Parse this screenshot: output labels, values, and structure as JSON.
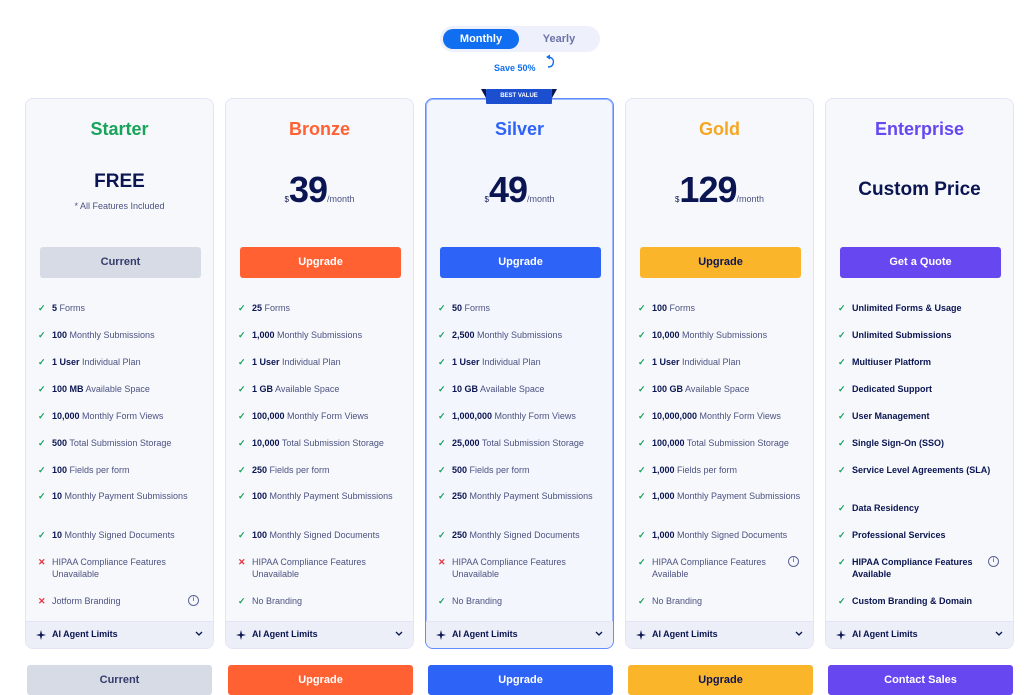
{
  "billing_toggle": {
    "monthly": "Monthly",
    "yearly": "Yearly",
    "save_note": "Save 50%"
  },
  "best_value": "BEST VALUE",
  "colors": {
    "starter": "#1aa35a",
    "bronze": "#ff6133",
    "silver": "#2d63f7",
    "gold": "#f5a623",
    "enterprise": "#6647f0",
    "gold_btn": "#fbb52b",
    "check": "#16a35b",
    "cross": "#e8333f"
  },
  "plans": [
    {
      "name": "Starter",
      "price_text": "FREE",
      "price_note": "* All Features Included",
      "button": "Current",
      "bottom_button": "Current",
      "features": [
        {
          "ok": true,
          "bold": "5",
          "text": " Forms"
        },
        {
          "ok": true,
          "bold": "100",
          "text": " Monthly Submissions"
        },
        {
          "ok": true,
          "bold": "1 User",
          "text": " Individual Plan"
        },
        {
          "ok": true,
          "bold": "100 MB",
          "text": " Available Space"
        },
        {
          "ok": true,
          "bold": "10,000",
          "text": " Monthly Form Views"
        },
        {
          "ok": true,
          "bold": "500",
          "text": " Total Submission Storage"
        },
        {
          "ok": true,
          "bold": "100",
          "text": " Fields per form"
        },
        {
          "ok": true,
          "bold": "10",
          "text": " Monthly Payment Submissions"
        },
        {
          "ok": true,
          "bold": "10",
          "text": " Monthly Signed Documents"
        },
        {
          "ok": false,
          "bold": "",
          "text": "HIPAA Compliance Features Unavailable"
        },
        {
          "ok": false,
          "bold": "",
          "text": "Jotform Branding",
          "info": true
        }
      ],
      "ai_label": "AI Agent Limits"
    },
    {
      "name": "Bronze",
      "currency": "$",
      "amount": "39",
      "period": "/month",
      "button": "Upgrade",
      "bottom_button": "Upgrade",
      "features": [
        {
          "ok": true,
          "bold": "25",
          "text": " Forms"
        },
        {
          "ok": true,
          "bold": "1,000",
          "text": " Monthly Submissions"
        },
        {
          "ok": true,
          "bold": "1 User",
          "text": " Individual Plan"
        },
        {
          "ok": true,
          "bold": "1 GB",
          "text": " Available Space"
        },
        {
          "ok": true,
          "bold": "100,000",
          "text": " Monthly Form Views"
        },
        {
          "ok": true,
          "bold": "10,000",
          "text": " Total Submission Storage"
        },
        {
          "ok": true,
          "bold": "250",
          "text": " Fields per form"
        },
        {
          "ok": true,
          "bold": "100",
          "text": " Monthly Payment Submissions"
        },
        {
          "ok": true,
          "bold": "100",
          "text": " Monthly Signed Documents"
        },
        {
          "ok": false,
          "bold": "",
          "text": "HIPAA Compliance Features Unavailable"
        },
        {
          "ok": true,
          "bold": "",
          "text": "No Branding"
        }
      ],
      "ai_label": "AI Agent Limits"
    },
    {
      "name": "Silver",
      "currency": "$",
      "amount": "49",
      "period": "/month",
      "button": "Upgrade",
      "bottom_button": "Upgrade",
      "features": [
        {
          "ok": true,
          "bold": "50",
          "text": " Forms"
        },
        {
          "ok": true,
          "bold": "2,500",
          "text": " Monthly Submissions"
        },
        {
          "ok": true,
          "bold": "1 User",
          "text": " Individual Plan"
        },
        {
          "ok": true,
          "bold": "10 GB",
          "text": " Available Space"
        },
        {
          "ok": true,
          "bold": "1,000,000",
          "text": " Monthly Form Views"
        },
        {
          "ok": true,
          "bold": "25,000",
          "text": " Total Submission Storage"
        },
        {
          "ok": true,
          "bold": "500",
          "text": " Fields per form"
        },
        {
          "ok": true,
          "bold": "250",
          "text": " Monthly Payment Submissions"
        },
        {
          "ok": true,
          "bold": "250",
          "text": " Monthly Signed Documents"
        },
        {
          "ok": false,
          "bold": "",
          "text": "HIPAA Compliance Features Unavailable"
        },
        {
          "ok": true,
          "bold": "",
          "text": "No Branding"
        }
      ],
      "ai_label": "AI Agent Limits"
    },
    {
      "name": "Gold",
      "currency": "$",
      "amount": "129",
      "period": "/month",
      "button": "Upgrade",
      "bottom_button": "Upgrade",
      "features": [
        {
          "ok": true,
          "bold": "100",
          "text": " Forms"
        },
        {
          "ok": true,
          "bold": "10,000",
          "text": " Monthly Submissions"
        },
        {
          "ok": true,
          "bold": "1 User",
          "text": " Individual Plan"
        },
        {
          "ok": true,
          "bold": "100 GB",
          "text": " Available Space"
        },
        {
          "ok": true,
          "bold": "10,000,000",
          "text": " Monthly Form Views"
        },
        {
          "ok": true,
          "bold": "100,000",
          "text": " Total Submission Storage"
        },
        {
          "ok": true,
          "bold": "1,000",
          "text": " Fields per form"
        },
        {
          "ok": true,
          "bold": "1,000",
          "text": " Monthly Payment Submissions"
        },
        {
          "ok": true,
          "bold": "1,000",
          "text": " Monthly Signed Documents"
        },
        {
          "ok": true,
          "bold": "",
          "text": "HIPAA Compliance Features Available",
          "info": true
        },
        {
          "ok": true,
          "bold": "",
          "text": "No Branding"
        }
      ],
      "ai_label": "AI Agent Limits"
    },
    {
      "name": "Enterprise",
      "price_text": "Custom Price",
      "button": "Get a Quote",
      "bottom_button": "Contact Sales",
      "features": [
        {
          "ok": true,
          "bold": "",
          "text": "Unlimited Forms & Usage"
        },
        {
          "ok": true,
          "bold": "",
          "text": "Unlimited Submissions"
        },
        {
          "ok": true,
          "bold": "",
          "text": "Multiuser Platform"
        },
        {
          "ok": true,
          "bold": "",
          "text": "Dedicated Support"
        },
        {
          "ok": true,
          "bold": "",
          "text": "User Management"
        },
        {
          "ok": true,
          "bold": "",
          "text": "Single Sign-On (SSO)"
        },
        {
          "ok": true,
          "bold": "",
          "text": "Service Level Agreements (SLA)"
        },
        {
          "ok": true,
          "bold": "",
          "text": "Data Residency"
        },
        {
          "ok": true,
          "bold": "",
          "text": "Professional Services"
        },
        {
          "ok": true,
          "bold": "",
          "text": "HIPAA Compliance Features Available",
          "info": true
        },
        {
          "ok": true,
          "bold": "",
          "text": "Custom Branding & Domain"
        }
      ],
      "ai_label": "AI Agent Limits"
    }
  ]
}
